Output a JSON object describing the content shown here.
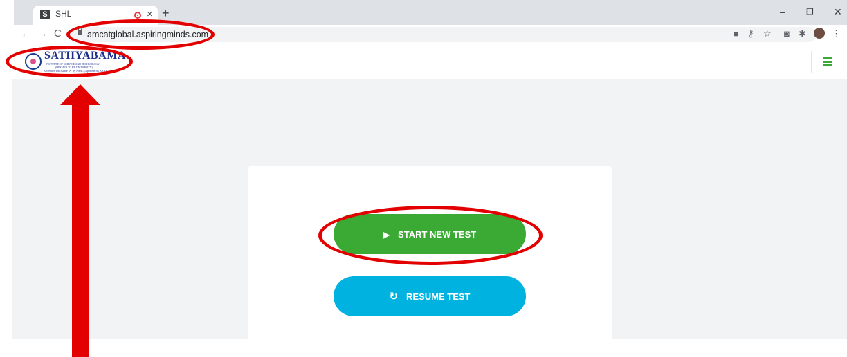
{
  "browser": {
    "tab_title": "SHL",
    "favicon_letter": "S",
    "url": "amcatglobal.aspiringminds.com",
    "icons": {
      "close_tab": "×",
      "new_tab": "+",
      "minimize": "–",
      "restore": "❐",
      "close_window": "✕",
      "back": "←",
      "forward": "→",
      "reload": "C",
      "camera": "■",
      "key": "⚷",
      "star": "☆",
      "screenshot": "◙",
      "extensions": "✱",
      "menu": "⋮"
    }
  },
  "header": {
    "logo_name": "SATHYABAMA",
    "logo_sub_lines": [
      "INSTITUTE OF SCIENCE AND TECHNOLOGY",
      "(DEEMED TO BE UNIVERSITY)",
      "Accredited with Grade \"A\" by NAAC | Approved by AICTE"
    ]
  },
  "main": {
    "start_button_label": "START NEW TEST",
    "resume_button_label": "RESUME TEST",
    "start_icon": "▶",
    "resume_icon": "↻"
  },
  "colors": {
    "start_green": "#3aaa35",
    "resume_blue": "#00b2e0",
    "annotation_red": "#e30000",
    "page_background": "#f2f3f5"
  }
}
